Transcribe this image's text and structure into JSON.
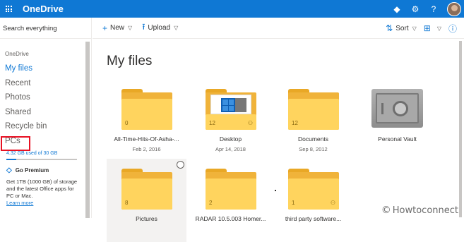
{
  "app": {
    "brand": "OneDrive"
  },
  "sidebar": {
    "search_placeholder": "Search everything",
    "section": "OneDrive",
    "items": [
      {
        "label": "My files"
      },
      {
        "label": "Recent"
      },
      {
        "label": "Photos"
      },
      {
        "label": "Shared"
      },
      {
        "label": "Recycle bin"
      },
      {
        "label": "PCs"
      }
    ],
    "storage": "4.32 GB used of 30 GB",
    "storage_fraction": 0.144,
    "premium_title": "Go Premium",
    "premium_text": "Get 1TB (1000 GB) of storage and the latest Office apps for PC or Mac.",
    "premium_link": "Learn more"
  },
  "toolbar": {
    "new_label": "New",
    "upload_label": "Upload",
    "sort_label": "Sort"
  },
  "main": {
    "title": "My files",
    "tiles": [
      {
        "name": "All-Time-Hits-Of-Asha-...",
        "date": "Feb 2, 2016",
        "count": "0"
      },
      {
        "name": "Desktop",
        "date": "Apr 14, 2018",
        "count": "12"
      },
      {
        "name": "Documents",
        "date": "Sep 8, 2012",
        "count": "12"
      },
      {
        "name": "Personal Vault",
        "date": ""
      },
      {
        "name": "Pictures",
        "date": "",
        "count": "8"
      },
      {
        "name": "RADAR 10.5.003 Homer...",
        "date": "",
        "count": "2"
      },
      {
        "name": "third party software...",
        "date": "",
        "count": "1"
      }
    ]
  },
  "watermark": "Howtoconnect",
  "colors": {
    "brand_blue": "#0f78d4",
    "folder_yellow": "#ffd45e",
    "highlight_red": "#e81123"
  }
}
